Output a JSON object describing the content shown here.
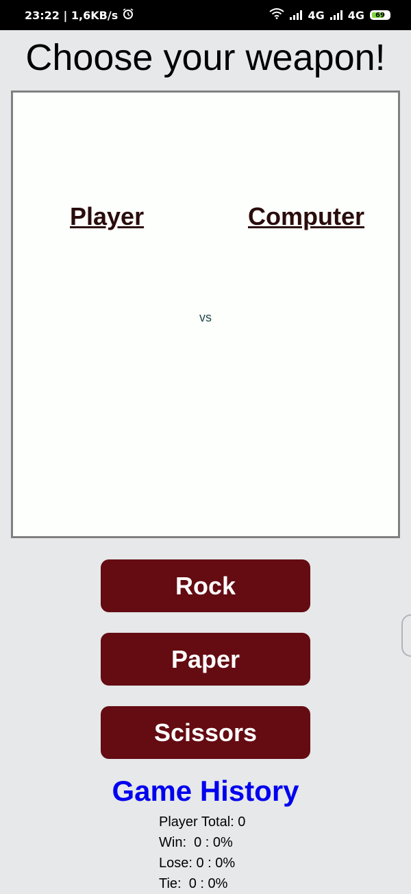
{
  "status_bar": {
    "time_speed": "23:22 | 1,6KB/s",
    "network1": "4G",
    "network2": "4G",
    "battery": "69"
  },
  "title": "Choose your weapon!",
  "arena": {
    "player_label": "Player",
    "computer_label": "Computer",
    "vs_label": "vs"
  },
  "buttons": {
    "rock": "Rock",
    "paper": "Paper",
    "scissors": "Scissors"
  },
  "history": {
    "title": "Game History",
    "player_total": "Player Total: 0",
    "win": "Win:  0 : 0%",
    "lose": "Lose: 0 : 0%",
    "tie": "Tie:  0 : 0%"
  },
  "colors": {
    "button_bg": "#640c12",
    "history_title": "#0000ee",
    "arena_border": "#808080",
    "background": "#e6e8ea"
  }
}
